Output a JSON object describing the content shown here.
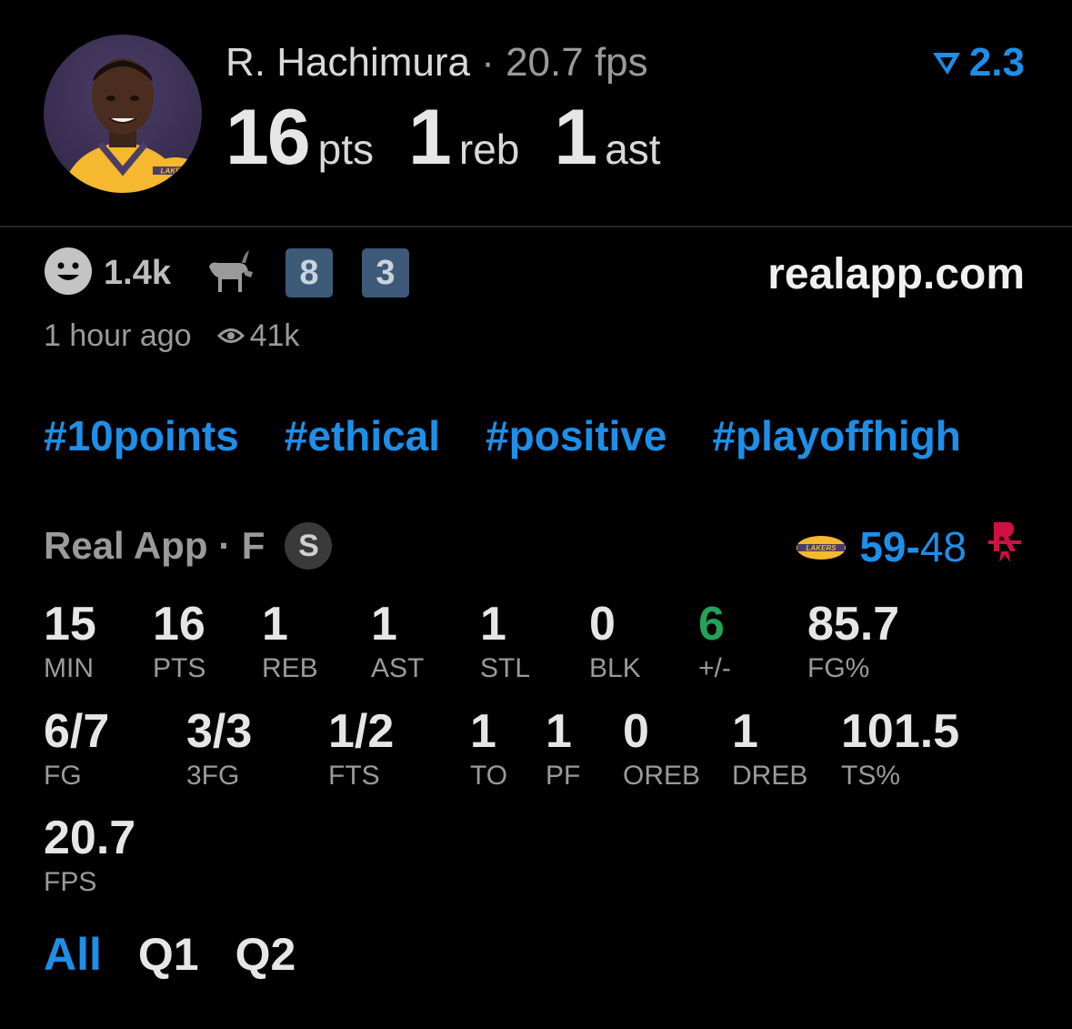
{
  "player": {
    "name": "R. Hachimura",
    "separator": " · ",
    "fps_text": "20.7 fps",
    "rating": "2.3",
    "headline": [
      {
        "value": "16",
        "unit": "pts"
      },
      {
        "value": "1",
        "unit": "reb"
      },
      {
        "value": "1",
        "unit": "ast"
      }
    ]
  },
  "reactions": {
    "count": "1.4k",
    "badges": [
      "8",
      "3"
    ],
    "site": "realapp.com",
    "time": "1 hour ago",
    "views": "41k"
  },
  "hashtags": [
    "#10points",
    "#ethical",
    "#positive",
    "#playoffhigh"
  ],
  "game": {
    "source": "Real App · F",
    "status_badge": "S",
    "home_score": "59",
    "dash": "-",
    "away_score": "48"
  },
  "stats_row1": [
    {
      "value": "15",
      "label": "MIN"
    },
    {
      "value": "16",
      "label": "PTS"
    },
    {
      "value": "1",
      "label": "REB"
    },
    {
      "value": "1",
      "label": "AST"
    },
    {
      "value": "1",
      "label": "STL"
    },
    {
      "value": "0",
      "label": "BLK"
    },
    {
      "value": "6",
      "label": "+/-"
    },
    {
      "value": "85.7",
      "label": "FG%"
    }
  ],
  "stats_row2": [
    {
      "value": "6/7",
      "label": "FG"
    },
    {
      "value": "3/3",
      "label": "3FG"
    },
    {
      "value": "1/2",
      "label": "FTS"
    },
    {
      "value": "1",
      "label": "TO"
    },
    {
      "value": "1",
      "label": "PF"
    },
    {
      "value": "0",
      "label": "OREB"
    },
    {
      "value": "1",
      "label": "DREB"
    },
    {
      "value": "101.5",
      "label": "TS%"
    }
  ],
  "stats_row3": [
    {
      "value": "20.7",
      "label": "FPS"
    }
  ],
  "tabs": [
    "All",
    "Q1",
    "Q2"
  ],
  "colors": {
    "accent": "#1d8fe8",
    "plus_minus_positive": "#21a35a",
    "badge_bg": "#3d5a78",
    "lakers_purple": "#4a3d66",
    "lakers_gold": "#f5b82e",
    "rockets_red": "#ce1141"
  }
}
